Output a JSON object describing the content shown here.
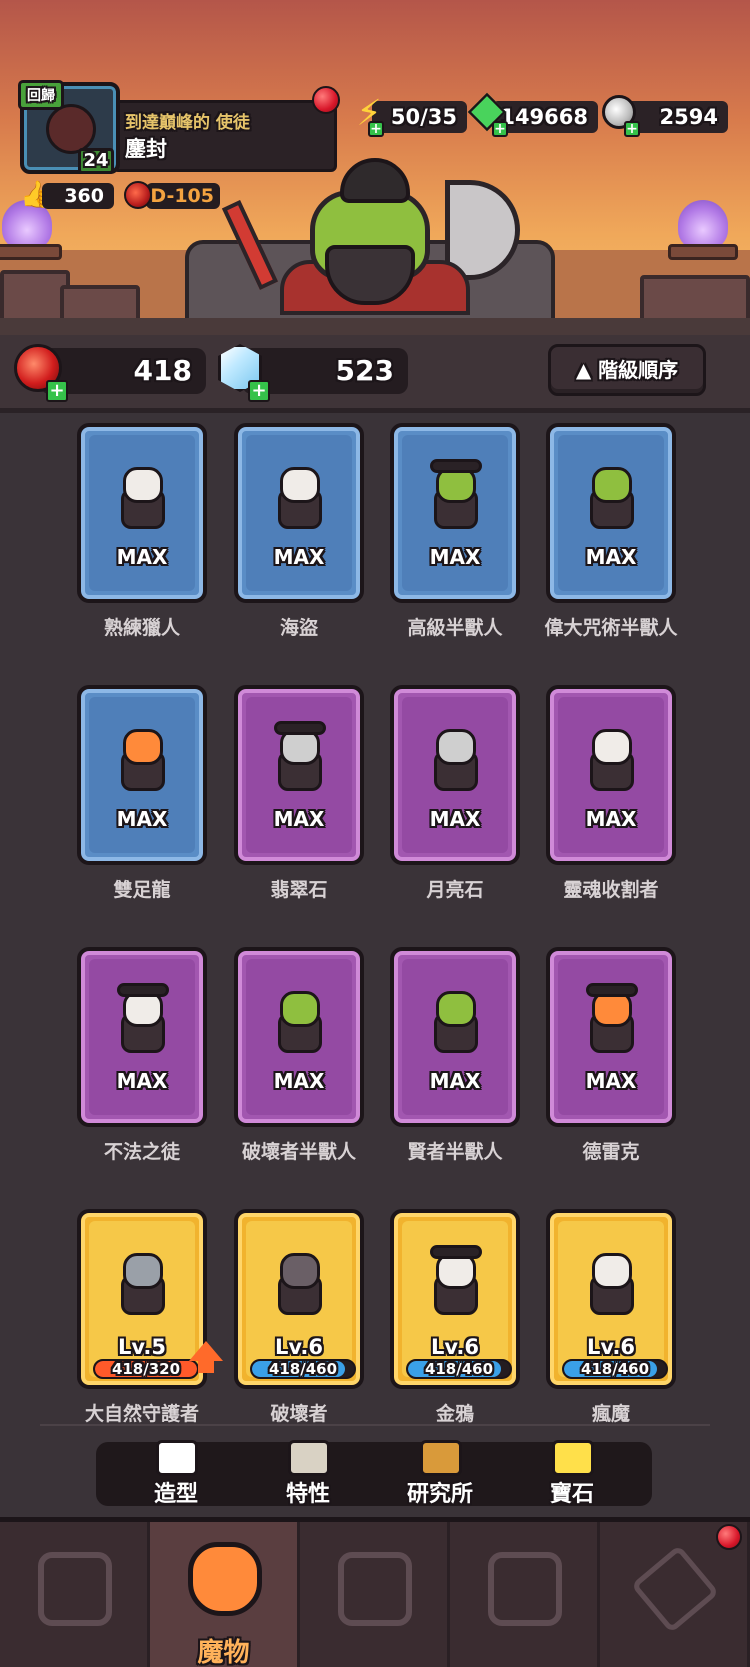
{
  "profile": {
    "return_badge": "回歸",
    "level": "24",
    "subtitle": "到達巔峰的 使徒",
    "name": "鏖封",
    "likes": "360",
    "dungeon": "D-105"
  },
  "top_resources": {
    "energy": "50/35",
    "green_gems": "149668",
    "silver": "2594"
  },
  "resources": {
    "red_gems": "418",
    "crystals": "523"
  },
  "sort_button": "▲ 階級順序",
  "monsters": [
    {
      "name": "熟練獵人",
      "rarity": "blue",
      "status": "MAX",
      "icon": "hunter-icon"
    },
    {
      "name": "海盜",
      "rarity": "blue",
      "status": "MAX",
      "icon": "pirate-icon"
    },
    {
      "name": "高級半獸人",
      "rarity": "blue",
      "status": "MAX",
      "icon": "orc-icon"
    },
    {
      "name": "偉大咒術半獸人",
      "rarity": "blue",
      "status": "MAX",
      "icon": "shaman-orc-icon"
    },
    {
      "name": "雙足龍",
      "rarity": "blue",
      "status": "MAX",
      "icon": "wyvern-icon"
    },
    {
      "name": "翡翠石",
      "rarity": "purple",
      "status": "MAX",
      "icon": "emerald-golem-icon"
    },
    {
      "name": "月亮石",
      "rarity": "purple",
      "status": "MAX",
      "icon": "moonstone-golem-icon"
    },
    {
      "name": "靈魂收割者",
      "rarity": "purple",
      "status": "MAX",
      "icon": "reaper-icon"
    },
    {
      "name": "不法之徒",
      "rarity": "purple",
      "status": "MAX",
      "icon": "outlaw-icon"
    },
    {
      "name": "破壞者半獸人",
      "rarity": "purple",
      "status": "MAX",
      "icon": "destroyer-orc-icon"
    },
    {
      "name": "賢者半獸人",
      "rarity": "purple",
      "status": "MAX",
      "icon": "sage-orc-icon"
    },
    {
      "name": "德雷克",
      "rarity": "purple",
      "status": "MAX",
      "icon": "drake-icon"
    },
    {
      "name": "大自然守護者",
      "rarity": "gold",
      "level": "Lv.5",
      "progress_text": "418/320",
      "progress": 1.0,
      "upgradable": true,
      "icon": "nature-guardian-icon"
    },
    {
      "name": "破壞者",
      "rarity": "gold",
      "level": "Lv.6",
      "progress_text": "418/460",
      "progress": 0.91,
      "upgradable": false,
      "icon": "destroyer-icon"
    },
    {
      "name": "金鴉",
      "rarity": "gold",
      "level": "Lv.6",
      "progress_text": "418/460",
      "progress": 0.91,
      "upgradable": false,
      "icon": "golden-crow-icon"
    },
    {
      "name": "瘋魔",
      "rarity": "gold",
      "level": "Lv.6",
      "progress_text": "418/460",
      "progress": 0.91,
      "upgradable": false,
      "icon": "madness-icon"
    }
  ],
  "submenu": [
    {
      "label": "造型",
      "icon": "costume-icon"
    },
    {
      "label": "特性",
      "icon": "trait-scroll-icon"
    },
    {
      "label": "研究所",
      "icon": "research-gear-icon"
    },
    {
      "label": "寶石",
      "icon": "gem-icon"
    }
  ],
  "bottom_nav": [
    {
      "label": "",
      "icon": "shop-cart-icon"
    },
    {
      "label": "魔物",
      "icon": "monster-icon"
    },
    {
      "label": "",
      "icon": "battle-swords-icon"
    },
    {
      "label": "",
      "icon": "rank-emblem-icon"
    },
    {
      "label": "",
      "icon": "ticket-icon"
    }
  ],
  "colors": {
    "blue_card": "#5a8dc6",
    "purple_card": "#a257b0",
    "gold_card": "#f1b32e",
    "progress_full": "#ff5a2a",
    "progress_partial": "#3aa0e8",
    "active_tab_label": "#ffb25a"
  }
}
